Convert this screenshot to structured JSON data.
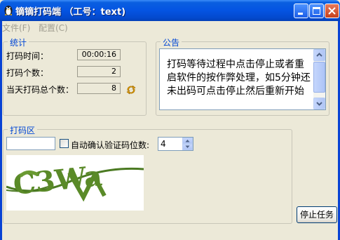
{
  "window": {
    "title": "镝镝打码端 （工号：text)"
  },
  "menu": {
    "items": [
      "文件(F)",
      "配置(C)"
    ]
  },
  "stats": {
    "title": "统计",
    "rows": [
      {
        "label": "打码时间：",
        "value": "00:00:16"
      },
      {
        "label": "打码个数：",
        "value": "2"
      },
      {
        "label": "当天打码总个数：",
        "value": "8"
      }
    ]
  },
  "notice": {
    "title": "公告",
    "text": "打码等待过程中点击停止或者重启软件的按作弊处理，如5分钟还未出码可点击停止然后重新开始"
  },
  "code_area": {
    "title": "打码区",
    "input_value": "",
    "checkbox_label": "自动确认验证码位数:",
    "digits_value": "4",
    "captcha_text": "C3Wa"
  },
  "buttons": {
    "stop": "停止任务"
  }
}
